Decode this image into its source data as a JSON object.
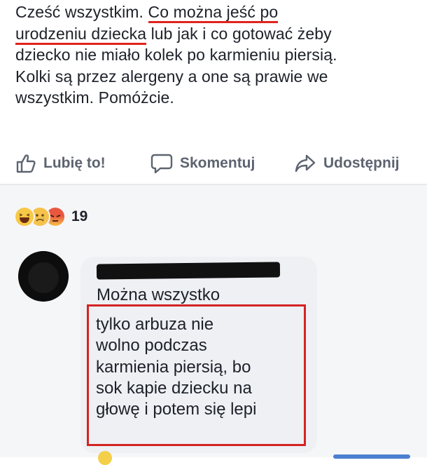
{
  "post": {
    "text_lines": [
      [
        "Cześć wszystkim. ",
        "Co można jeść po"
      ],
      [
        "urodzeniu dziecka",
        " lub jak i co gotować żeby"
      ],
      [
        "dziecko nie miało kolek po karmieniu piersią."
      ],
      [
        "Kolki są przez alergeny a one są prawie we"
      ],
      [
        "wszystkim. Pomóżcie."
      ]
    ]
  },
  "actions": {
    "like": "Lubię to!",
    "comment": "Skomentuj",
    "share": "Udostępnij"
  },
  "reactions": {
    "types": [
      "haha",
      "sad",
      "angry"
    ],
    "count": "19"
  },
  "comment": {
    "first_line": "Można wszystko",
    "lines": [
      "tylko arbuza nie",
      "wolno podczas",
      "karmienia piersią, bo",
      "sok kapie dziecku na",
      "głowę i potem się lepi"
    ]
  },
  "colors": {
    "underline": "#e0231c",
    "box": "#d42323",
    "action_text": "#5c6470"
  }
}
